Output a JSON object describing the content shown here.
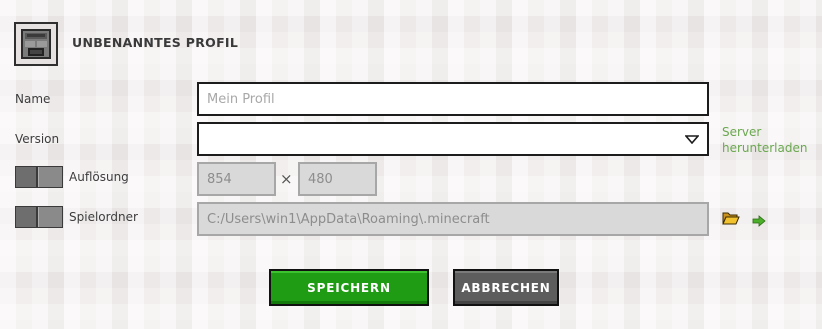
{
  "profile": {
    "title": "UNBENANNTES PROFIL",
    "icon": "furnace-block-icon"
  },
  "name_field": {
    "label": "Name",
    "value": "",
    "placeholder": "Mein Profil"
  },
  "version_field": {
    "label": "Version",
    "value": "",
    "dropdown_icon": "triangle-down-icon",
    "server_link_line1": "Server",
    "server_link_line2": "herunterladen",
    "link_color": "#6aa84f"
  },
  "resolution": {
    "label": "Auflösung",
    "width": "854",
    "separator": "×",
    "height": "480",
    "toggle_on": false
  },
  "game_folder": {
    "label": "Spielordner",
    "path": "C:/Users\\win1\\AppData\\Roaming\\.minecraft",
    "toggle_on": false,
    "folder_icon": "folder-icon",
    "open_icon": "arrow-right-icon"
  },
  "buttons": {
    "save": "SPEICHERN",
    "cancel": "ABBRECHEN",
    "save_color": "#1f9c13",
    "cancel_color": "#5d5d5d"
  }
}
